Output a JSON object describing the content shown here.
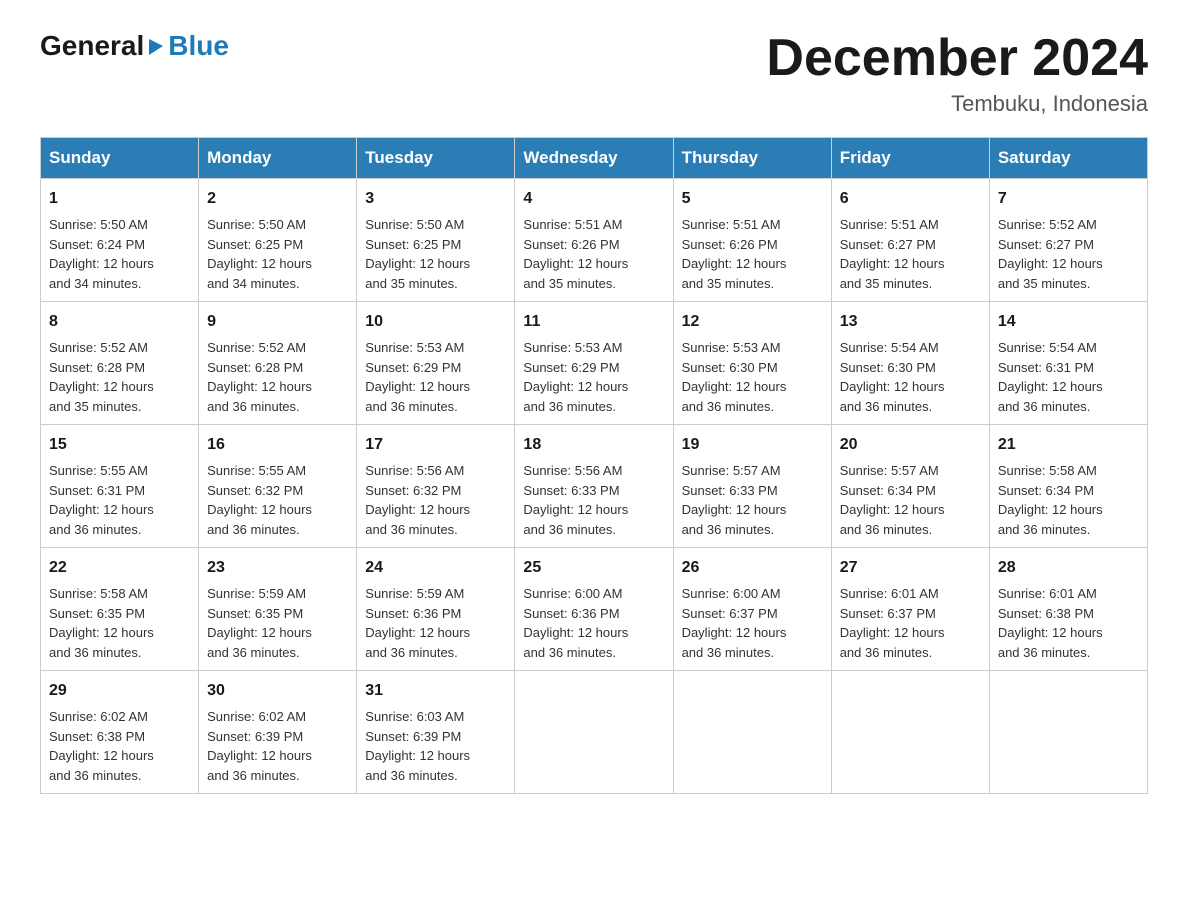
{
  "header": {
    "logo_general": "General",
    "logo_blue": "Blue",
    "month_title": "December 2024",
    "location": "Tembuku, Indonesia"
  },
  "days_of_week": [
    "Sunday",
    "Monday",
    "Tuesday",
    "Wednesday",
    "Thursday",
    "Friday",
    "Saturday"
  ],
  "weeks": [
    [
      {
        "day": "1",
        "sunrise": "5:50 AM",
        "sunset": "6:24 PM",
        "daylight": "12 hours and 34 minutes."
      },
      {
        "day": "2",
        "sunrise": "5:50 AM",
        "sunset": "6:25 PM",
        "daylight": "12 hours and 34 minutes."
      },
      {
        "day": "3",
        "sunrise": "5:50 AM",
        "sunset": "6:25 PM",
        "daylight": "12 hours and 35 minutes."
      },
      {
        "day": "4",
        "sunrise": "5:51 AM",
        "sunset": "6:26 PM",
        "daylight": "12 hours and 35 minutes."
      },
      {
        "day": "5",
        "sunrise": "5:51 AM",
        "sunset": "6:26 PM",
        "daylight": "12 hours and 35 minutes."
      },
      {
        "day": "6",
        "sunrise": "5:51 AM",
        "sunset": "6:27 PM",
        "daylight": "12 hours and 35 minutes."
      },
      {
        "day": "7",
        "sunrise": "5:52 AM",
        "sunset": "6:27 PM",
        "daylight": "12 hours and 35 minutes."
      }
    ],
    [
      {
        "day": "8",
        "sunrise": "5:52 AM",
        "sunset": "6:28 PM",
        "daylight": "12 hours and 35 minutes."
      },
      {
        "day": "9",
        "sunrise": "5:52 AM",
        "sunset": "6:28 PM",
        "daylight": "12 hours and 36 minutes."
      },
      {
        "day": "10",
        "sunrise": "5:53 AM",
        "sunset": "6:29 PM",
        "daylight": "12 hours and 36 minutes."
      },
      {
        "day": "11",
        "sunrise": "5:53 AM",
        "sunset": "6:29 PM",
        "daylight": "12 hours and 36 minutes."
      },
      {
        "day": "12",
        "sunrise": "5:53 AM",
        "sunset": "6:30 PM",
        "daylight": "12 hours and 36 minutes."
      },
      {
        "day": "13",
        "sunrise": "5:54 AM",
        "sunset": "6:30 PM",
        "daylight": "12 hours and 36 minutes."
      },
      {
        "day": "14",
        "sunrise": "5:54 AM",
        "sunset": "6:31 PM",
        "daylight": "12 hours and 36 minutes."
      }
    ],
    [
      {
        "day": "15",
        "sunrise": "5:55 AM",
        "sunset": "6:31 PM",
        "daylight": "12 hours and 36 minutes."
      },
      {
        "day": "16",
        "sunrise": "5:55 AM",
        "sunset": "6:32 PM",
        "daylight": "12 hours and 36 minutes."
      },
      {
        "day": "17",
        "sunrise": "5:56 AM",
        "sunset": "6:32 PM",
        "daylight": "12 hours and 36 minutes."
      },
      {
        "day": "18",
        "sunrise": "5:56 AM",
        "sunset": "6:33 PM",
        "daylight": "12 hours and 36 minutes."
      },
      {
        "day": "19",
        "sunrise": "5:57 AM",
        "sunset": "6:33 PM",
        "daylight": "12 hours and 36 minutes."
      },
      {
        "day": "20",
        "sunrise": "5:57 AM",
        "sunset": "6:34 PM",
        "daylight": "12 hours and 36 minutes."
      },
      {
        "day": "21",
        "sunrise": "5:58 AM",
        "sunset": "6:34 PM",
        "daylight": "12 hours and 36 minutes."
      }
    ],
    [
      {
        "day": "22",
        "sunrise": "5:58 AM",
        "sunset": "6:35 PM",
        "daylight": "12 hours and 36 minutes."
      },
      {
        "day": "23",
        "sunrise": "5:59 AM",
        "sunset": "6:35 PM",
        "daylight": "12 hours and 36 minutes."
      },
      {
        "day": "24",
        "sunrise": "5:59 AM",
        "sunset": "6:36 PM",
        "daylight": "12 hours and 36 minutes."
      },
      {
        "day": "25",
        "sunrise": "6:00 AM",
        "sunset": "6:36 PM",
        "daylight": "12 hours and 36 minutes."
      },
      {
        "day": "26",
        "sunrise": "6:00 AM",
        "sunset": "6:37 PM",
        "daylight": "12 hours and 36 minutes."
      },
      {
        "day": "27",
        "sunrise": "6:01 AM",
        "sunset": "6:37 PM",
        "daylight": "12 hours and 36 minutes."
      },
      {
        "day": "28",
        "sunrise": "6:01 AM",
        "sunset": "6:38 PM",
        "daylight": "12 hours and 36 minutes."
      }
    ],
    [
      {
        "day": "29",
        "sunrise": "6:02 AM",
        "sunset": "6:38 PM",
        "daylight": "12 hours and 36 minutes."
      },
      {
        "day": "30",
        "sunrise": "6:02 AM",
        "sunset": "6:39 PM",
        "daylight": "12 hours and 36 minutes."
      },
      {
        "day": "31",
        "sunrise": "6:03 AM",
        "sunset": "6:39 PM",
        "daylight": "12 hours and 36 minutes."
      },
      null,
      null,
      null,
      null
    ]
  ],
  "labels": {
    "sunrise": "Sunrise:",
    "sunset": "Sunset:",
    "daylight": "Daylight:"
  }
}
